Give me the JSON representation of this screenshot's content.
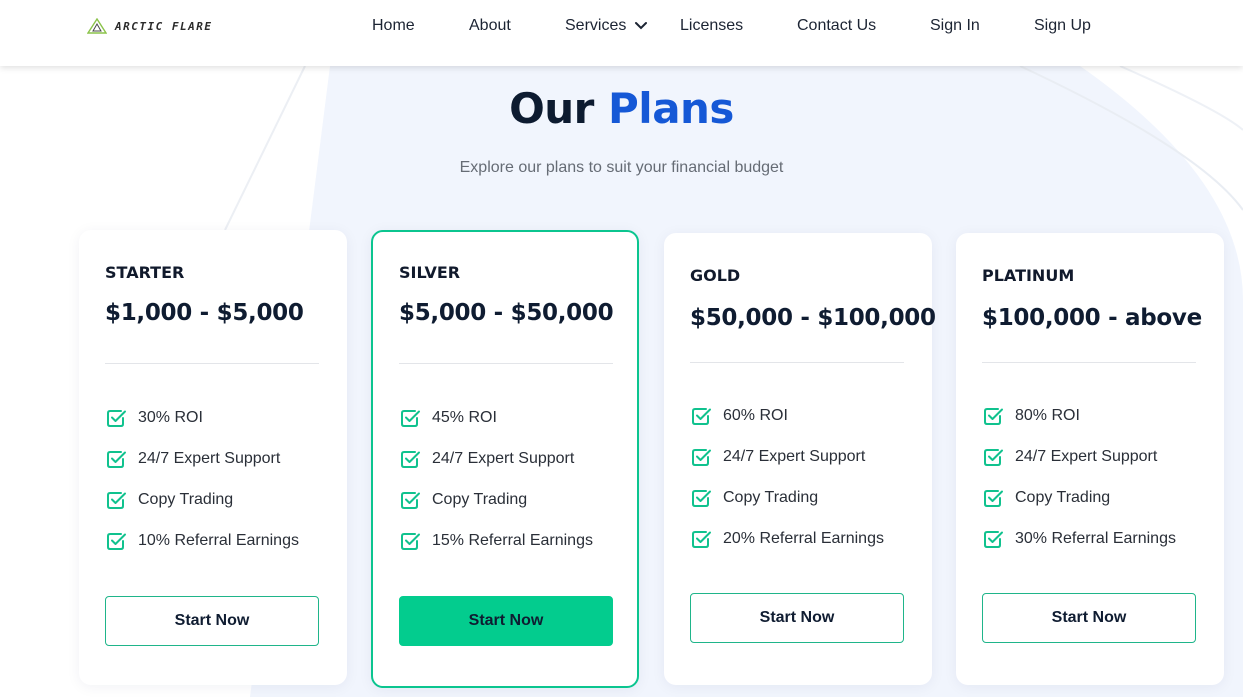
{
  "nav": {
    "logo_text": "ARCTIC FLARE",
    "items": [
      {
        "label": "Home"
      },
      {
        "label": "About"
      },
      {
        "label": "Services"
      },
      {
        "label": "Licenses"
      },
      {
        "label": "Contact Us"
      },
      {
        "label": "Sign In"
      },
      {
        "label": "Sign Up"
      }
    ]
  },
  "hero": {
    "title_main": "Our",
    "title_accent": "Plans",
    "subtitle": "Explore our plans to suit your financial budget"
  },
  "plans": [
    {
      "name": "STARTER",
      "range": "$1,000 - $5,000",
      "features": [
        "30% ROI",
        "24/7 Expert Support",
        "Copy Trading",
        "10% Referral Earnings"
      ],
      "button": "Start Now"
    },
    {
      "name": "SILVER",
      "range": "$5,000 - $50,000",
      "features": [
        "45% ROI",
        "24/7 Expert Support",
        "Copy Trading",
        "15% Referral Earnings"
      ],
      "button": "Start Now"
    },
    {
      "name": "GOLD",
      "range": "$50,000 - $100,000",
      "features": [
        "60% ROI",
        "24/7 Expert Support",
        "Copy Trading",
        "20% Referral Earnings"
      ],
      "button": "Start Now"
    },
    {
      "name": "PLATINUM",
      "range": "$100,000 - above",
      "features": [
        "80% ROI",
        "24/7 Expert Support",
        "Copy Trading",
        "30% Referral Earnings"
      ],
      "button": "Start Now"
    }
  ],
  "colors": {
    "accent_blue": "#1558d6",
    "accent_green": "#03cc8e",
    "heading": "#0d1b30"
  },
  "icons": {
    "check": "check-square-icon",
    "chevron": "chevron-down-icon",
    "logo": "triangle-logo-icon"
  }
}
